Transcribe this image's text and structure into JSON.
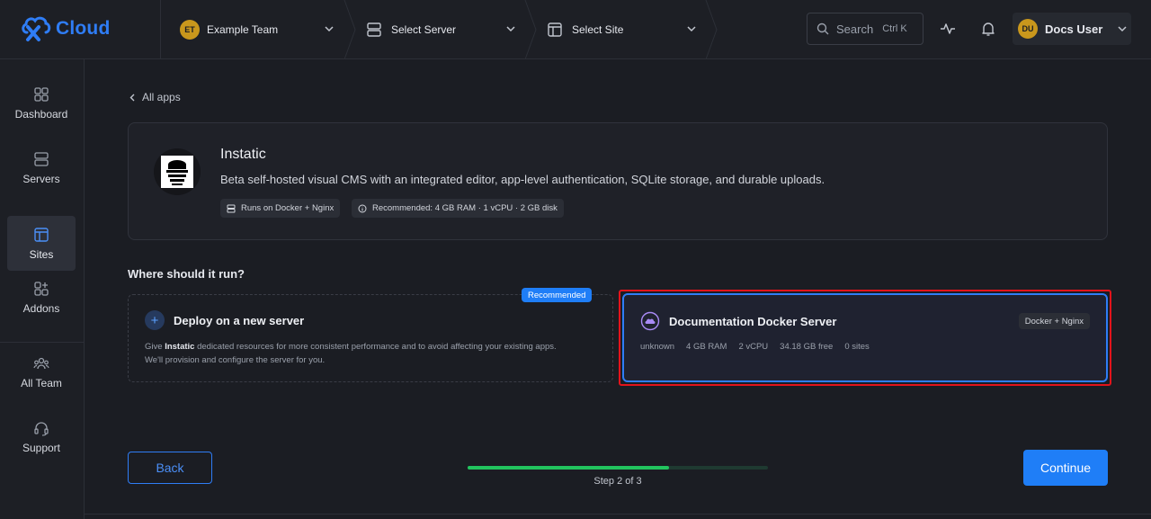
{
  "brand": {
    "name": "Cloud",
    "color": "#2f7df6"
  },
  "breadcrumbs": {
    "team": {
      "initials": "ET",
      "label": "Example Team"
    },
    "server": {
      "label": "Select Server"
    },
    "site": {
      "label": "Select Site"
    }
  },
  "search": {
    "label": "Search",
    "shortcut": "Ctrl K"
  },
  "user": {
    "initials": "DU",
    "name": "Docs User"
  },
  "sidebar": {
    "items": [
      {
        "label": "Dashboard",
        "icon": "dashboard-icon"
      },
      {
        "label": "Servers",
        "icon": "servers-icon"
      },
      {
        "label": "Sites",
        "icon": "sites-icon",
        "active": true
      },
      {
        "label": "Addons",
        "icon": "addons-icon"
      },
      {
        "label": "All Team",
        "icon": "team-icon"
      },
      {
        "label": "Support",
        "icon": "headset-icon"
      }
    ]
  },
  "back_link": "All apps",
  "app": {
    "name": "Instatic",
    "description": "Beta self-hosted visual CMS with an integrated editor, app-level authentication, SQLite storage, and durable uploads.",
    "chips": [
      "Runs on Docker + Nginx",
      "Recommended: 4 GB RAM · 1 vCPU · 2 GB disk"
    ]
  },
  "section_title": "Where should it run?",
  "new_server": {
    "title": "Deploy on a new server",
    "badge": "Recommended",
    "desc_prefix": "Give",
    "desc_app": "Instatic",
    "desc_rest": "dedicated resources for more consistent performance and to avoid affecting your existing apps.",
    "desc_line2": "We'll provision and configure the server for you."
  },
  "existing_server": {
    "title": "Documentation Docker Server",
    "tag": "Docker + Nginx",
    "stats": [
      "unknown",
      "4 GB RAM",
      "2 vCPU",
      "34.18 GB free",
      "0 sites"
    ],
    "selected": true
  },
  "footer": {
    "back_label": "Back",
    "continue_label": "Continue",
    "step_label": "Step 2 of 3",
    "progress": 0.67
  },
  "colors": {
    "accent": "#1f7ef7",
    "progress": "#22c45e",
    "selection": "#e3131b"
  }
}
